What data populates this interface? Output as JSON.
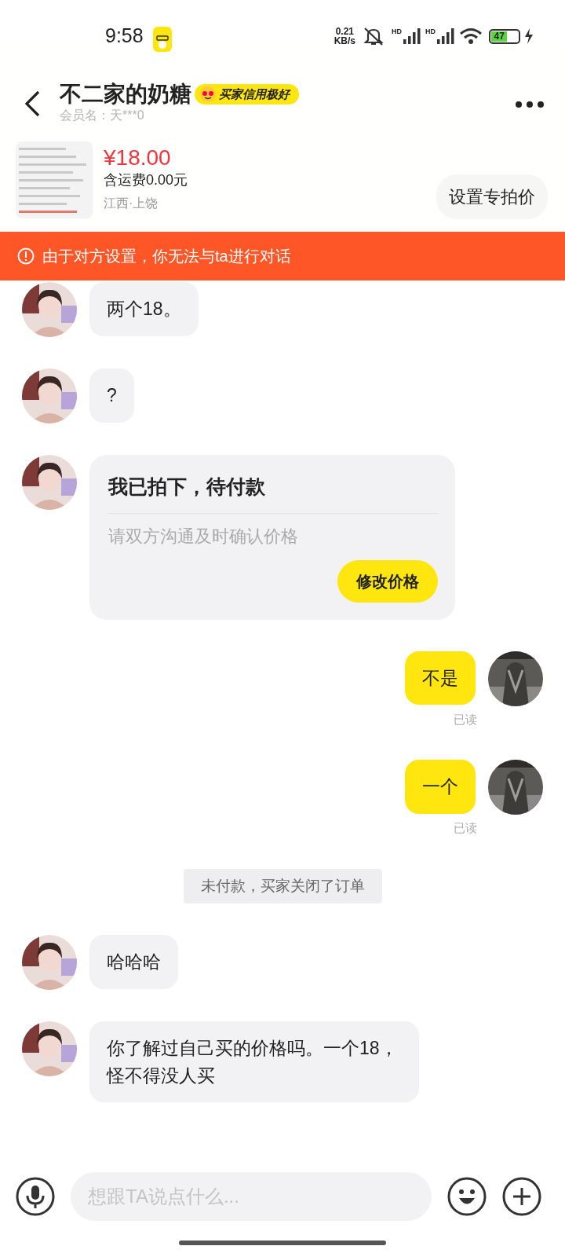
{
  "status_bar": {
    "time": "9:58",
    "net_speed_value": "0.21",
    "net_speed_unit": "KB/s",
    "signal_labels": [
      "HD",
      "HD"
    ],
    "battery": "47"
  },
  "header": {
    "title": "不二家的奶糖",
    "badge": "买家信用极好",
    "member": "会员名：天***0"
  },
  "product": {
    "price": "¥18.00",
    "shipping": "含运费0.00元",
    "location": "江西·上饶",
    "action": "设置专拍价"
  },
  "notice": "由于对方设置，你无法与ta进行对话",
  "messages": [
    {
      "kind": "text",
      "outgoing": false,
      "text": "两个18。"
    },
    {
      "kind": "text",
      "outgoing": false,
      "text": "?"
    },
    {
      "kind": "order",
      "outgoing": false,
      "title": "我已拍下，待付款",
      "subtitle": "请双方沟通及时确认价格",
      "button": "修改价格"
    },
    {
      "kind": "text",
      "outgoing": true,
      "text": "不是",
      "status": "已读"
    },
    {
      "kind": "text",
      "outgoing": true,
      "text": "一个",
      "status": "已读"
    },
    {
      "kind": "system",
      "text": "未付款，买家关闭了订单"
    },
    {
      "kind": "text",
      "outgoing": false,
      "text": "哈哈哈"
    },
    {
      "kind": "text",
      "outgoing": false,
      "text": "你了解过自己买的价格吗。一个18，怪不得没人买"
    }
  ],
  "input": {
    "placeholder": "想跟TA说点什么..."
  }
}
